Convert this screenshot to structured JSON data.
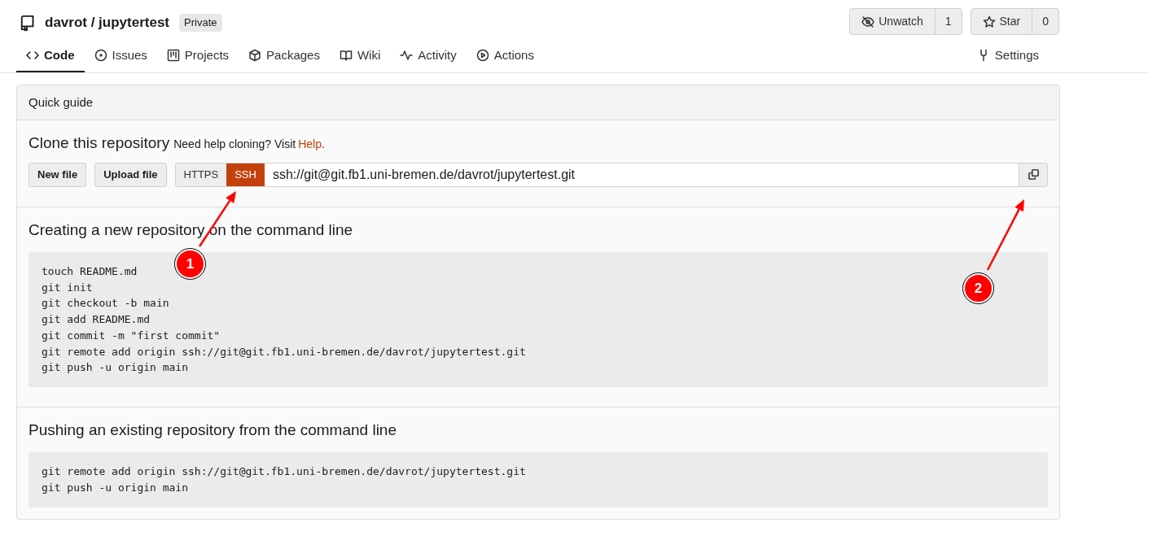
{
  "repo": {
    "owner": "davrot",
    "separator": "/",
    "name": "jupytertest",
    "visibility": "Private"
  },
  "watch": {
    "label": "Unwatch",
    "count": "1"
  },
  "star": {
    "label": "Star",
    "count": "0"
  },
  "tabs": [
    {
      "kind": "code",
      "label": "Code",
      "selected": true
    },
    {
      "kind": "issues",
      "label": "Issues",
      "selected": false
    },
    {
      "kind": "projects",
      "label": "Projects",
      "selected": false
    },
    {
      "kind": "packages",
      "label": "Packages",
      "selected": false
    },
    {
      "kind": "wiki",
      "label": "Wiki",
      "selected": false
    },
    {
      "kind": "activity",
      "label": "Activity",
      "selected": false
    },
    {
      "kind": "actions",
      "label": "Actions",
      "selected": false
    }
  ],
  "settings_tab": {
    "label": "Settings",
    "selected": false
  },
  "quick_guide": {
    "title": "Quick guide",
    "clone": {
      "title": "Clone this repository",
      "help_text": "Need help cloning? Visit",
      "help_link": "Help",
      "help_end": ".",
      "buttons": [
        "New file",
        "Upload file"
      ],
      "protocols": [
        {
          "label": "HTTPS",
          "selected": false
        },
        {
          "label": "SSH",
          "selected": true
        }
      ],
      "url": "ssh://git@git.fb1.uni-bremen.de/davrot/jupytertest.git"
    },
    "sections": [
      {
        "title": "Creating a new repository on the command line",
        "code": [
          "touch README.md",
          "git init",
          "git checkout -b main",
          "git add README.md",
          "git commit -m \"first commit\"",
          "git remote add origin ssh://git@git.fb1.uni-bremen.de/davrot/jupytertest.git",
          "git push -u origin main"
        ]
      },
      {
        "title": "Pushing an existing repository from the command line",
        "code": [
          "git remote add origin ssh://git@git.fb1.uni-bremen.de/davrot/jupytertest.git",
          "git push -u origin main"
        ]
      }
    ]
  },
  "annotations": [
    {
      "label": "1"
    },
    {
      "label": "2"
    }
  ]
}
